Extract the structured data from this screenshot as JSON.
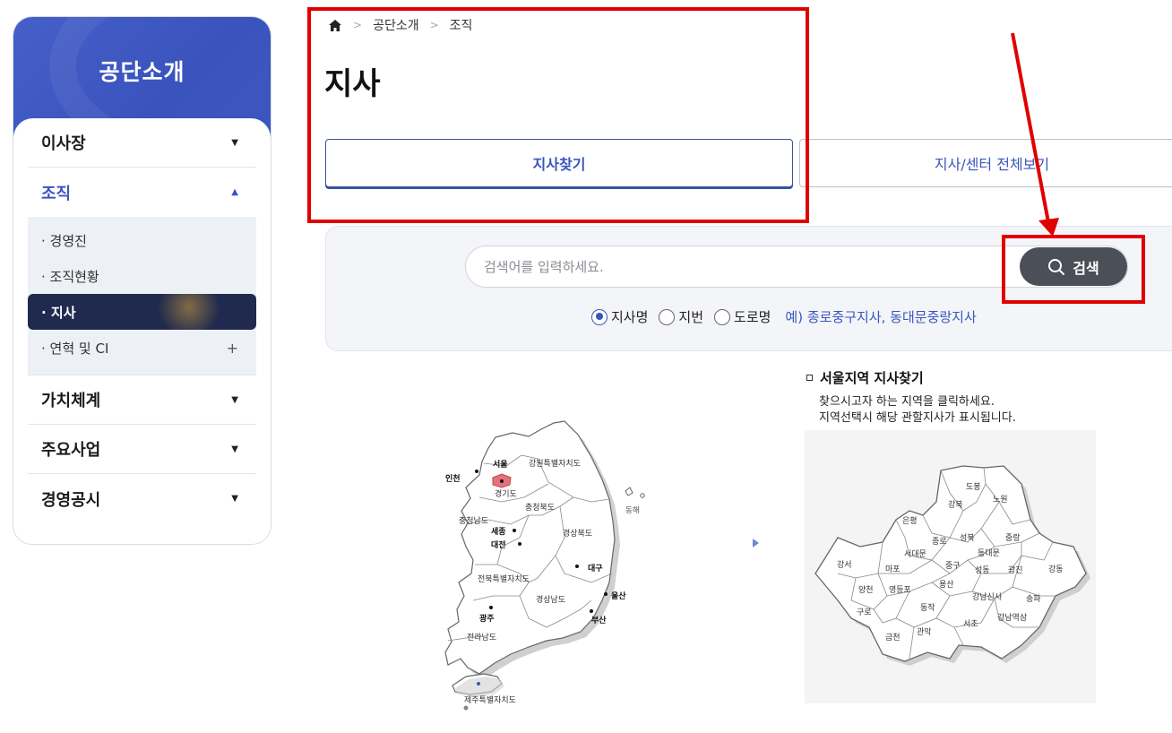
{
  "sidebar": {
    "title": "공단소개",
    "items": [
      {
        "label": "이사장",
        "caret": "▼"
      },
      {
        "label": "조직",
        "caret": "▲"
      },
      {
        "label": "가치체계",
        "caret": "▼"
      },
      {
        "label": "주요사업",
        "caret": "▼"
      },
      {
        "label": "경영공시",
        "caret": "▼"
      }
    ],
    "submenu": [
      {
        "label": "· 경영진"
      },
      {
        "label": "· 조직현황"
      },
      {
        "label": "· 지사"
      },
      {
        "label": "· 연혁 및 CI",
        "extra": "+"
      }
    ]
  },
  "breadcrumb": {
    "icon": "home-icon",
    "items": [
      "공단소개",
      "조직"
    ],
    "separator": ">"
  },
  "page": {
    "title": "지사"
  },
  "tabs": [
    {
      "label": "지사찾기"
    },
    {
      "label": "지사/센터 전체보기"
    }
  ],
  "search": {
    "placeholder": "검색어를 입력하세요.",
    "button_label": "검색",
    "button_icon": "search-icon",
    "options": [
      {
        "label": "지사명",
        "checked": true
      },
      {
        "label": "지번",
        "checked": false
      },
      {
        "label": "도로명",
        "checked": false
      }
    ],
    "example": "예) 종로중구지사, 동대문중랑지사"
  },
  "korea_map": {
    "labels": {
      "seoul": "서울",
      "incheon": "인천",
      "gyeonggi": "경기도",
      "gangwon": "강원특별자치도",
      "chungbuk": "충청북도",
      "chungnam": "충청남도",
      "sejong": "세종",
      "daejeon": "대전",
      "gyeongbuk": "경상북도",
      "daegu": "대구",
      "jeonbuk": "전북특별자치도",
      "gyeongnam": "경상남도",
      "ulsan": "울산",
      "busan": "부산",
      "gwangju": "광주",
      "jeonnam": "전라남도",
      "jeju": "제주특별자치도",
      "donghae": "동해"
    },
    "highlight_color": "#e5707a"
  },
  "seoul_section": {
    "heading": "서울지역 지사찾기",
    "desc_line1": "찾으시고자 하는 지역을 클릭하세요.",
    "desc_line2": "지역선택시 해당 관할지사가 표시됩니다.",
    "districts": {
      "dobong": "도봉",
      "nowon": "노원",
      "gangbuk": "강북",
      "eunpyeong": "은평",
      "seongbuk": "성북",
      "jongno": "종로",
      "jungnang": "중랑",
      "seodaemun": "서대문",
      "dongdaemun": "동대문",
      "junggu": "중구",
      "gangseo": "강서",
      "mapo": "마포",
      "seongdong": "성동",
      "gwangjin": "광진",
      "gangdong": "강동",
      "yangcheon": "양천",
      "yeongdeungpo": "영등포",
      "yongsan": "용산",
      "gangnamsinsa": "강남신사",
      "songpa": "송파",
      "guro": "구로",
      "dongjak": "동작",
      "seocho": "서초",
      "gangnamyeoksam": "강남역삼",
      "geumcheon": "금천",
      "gwanak": "관악"
    }
  },
  "colors": {
    "accent": "#3a55bf",
    "sidebar_head": "#4660c9",
    "current_submenu": "#1f2a4e",
    "search_button": "#4b4f58",
    "annotation": "#e00000"
  }
}
